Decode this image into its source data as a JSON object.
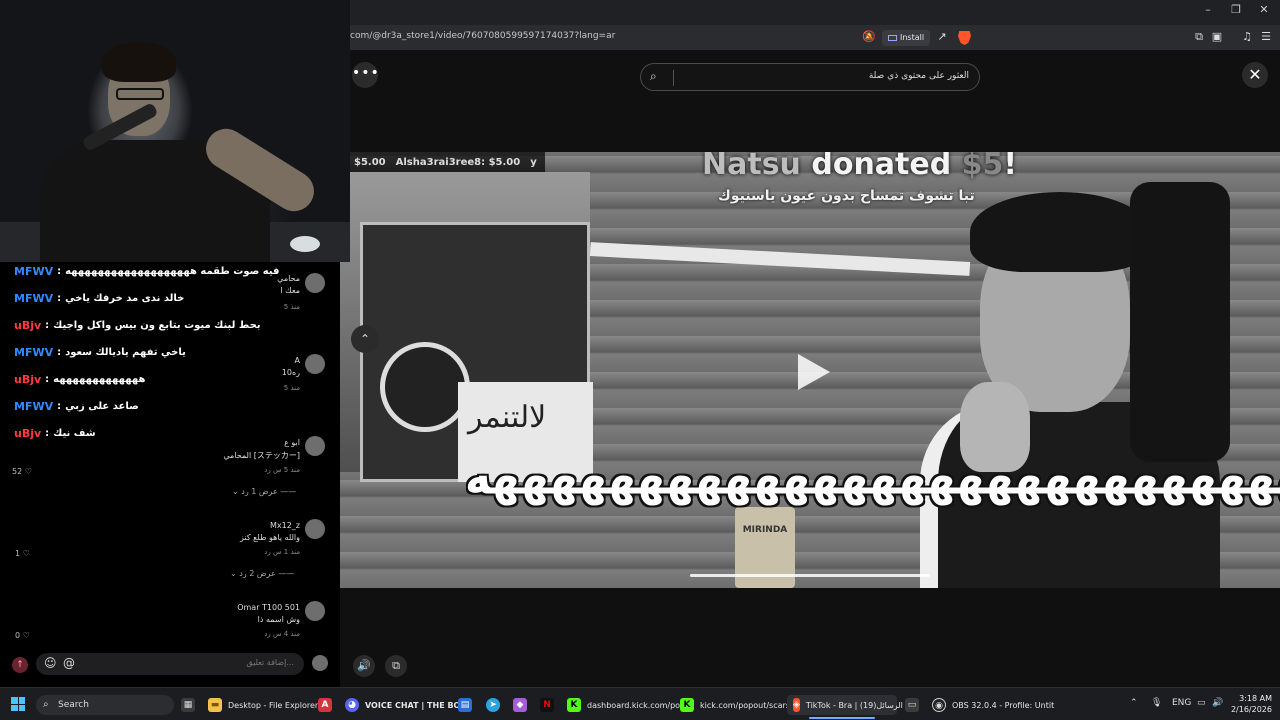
{
  "browser": {
    "url": "com/@dr3a_store1/video/7607080599597174037?lang=ar",
    "install_label": "Install",
    "brave_badge": "B"
  },
  "tiktok": {
    "search_placeholder": "العثور على محتوى ذي صلة",
    "comment_placeholder": "إضافة تعليق...",
    "comments": [
      {
        "name": "محامي",
        "text": "معك ا",
        "meta": "منذ 5"
      },
      {
        "name": "A",
        "text": "10ره",
        "meta": "منذ 5"
      },
      {
        "name": "ابو ع",
        "text": "المحامي [ステッカー]",
        "meta": "منذ 5 س رد",
        "likes": "52",
        "replies": "عرض 1 رد"
      },
      {
        "name": "Mx12_z",
        "text": "والله ياهو طلع كنز",
        "meta": "منذ 1 س رد",
        "likes": "1",
        "replies": "عرض 2 رد"
      },
      {
        "name": "Omar T100 501",
        "text": "وش اسمه ذا",
        "meta": "منذ 4 س رد",
        "likes": "0"
      }
    ]
  },
  "obs_chat": [
    {
      "user": "MFWV",
      "color": "#2f8bff",
      "msg": "فيه صوت طقمه هههههههههههههههههههه"
    },
    {
      "user": "MFWV",
      "color": "#2f8bff",
      "msg": "خالد ندى مد خرفك ياخي"
    },
    {
      "user": "uBjv",
      "color": "#ff3b3b",
      "msg": "بحط لبنك ميوت بتابع ون بيس واكل واجيك"
    },
    {
      "user": "MFWV",
      "color": "#2f8bff",
      "msg": "ياخي تفهم ياديالك سعود"
    },
    {
      "user": "uBjv",
      "color": "#ff3b3b",
      "msg": "هههههههههههههه"
    },
    {
      "user": "MFWV",
      "color": "#2f8bff",
      "msg": "صاعد على زبي"
    },
    {
      "user": "uBjv",
      "color": "#ff3b3b",
      "msg": "شف نيك"
    }
  ],
  "video": {
    "donor_ticker": [
      "$5.00",
      "Alsha3rai3ree8: $5.00",
      "y"
    ],
    "donated_name": "Natsu",
    "donated_word": "donated",
    "donated_amount": "$5",
    "donated_bang": "!",
    "donation_message": "تبا تشوف تمساح بدون عيون ياسنيوك",
    "sign_text": "لالتنمر",
    "caption": "هههههههههههههههههههههههههههههه",
    "cup_text": "MIRINDA"
  },
  "taskbar": {
    "search_label": "Search",
    "items": [
      {
        "label": "Desktop - File Explorer"
      },
      {
        "label": "VOICE CHAT | THE BOY"
      },
      {
        "label": "dashboard.kick.com/po"
      },
      {
        "label": "kick.com/popout/scarsa"
      },
      {
        "label": "TikTok - Bra | الرسائل(19)"
      },
      {
        "label": "OBS 32.0.4 - Profile: Untit"
      }
    ],
    "lang": "ENG",
    "time": "3:18 AM",
    "date": "2/16/2026"
  }
}
